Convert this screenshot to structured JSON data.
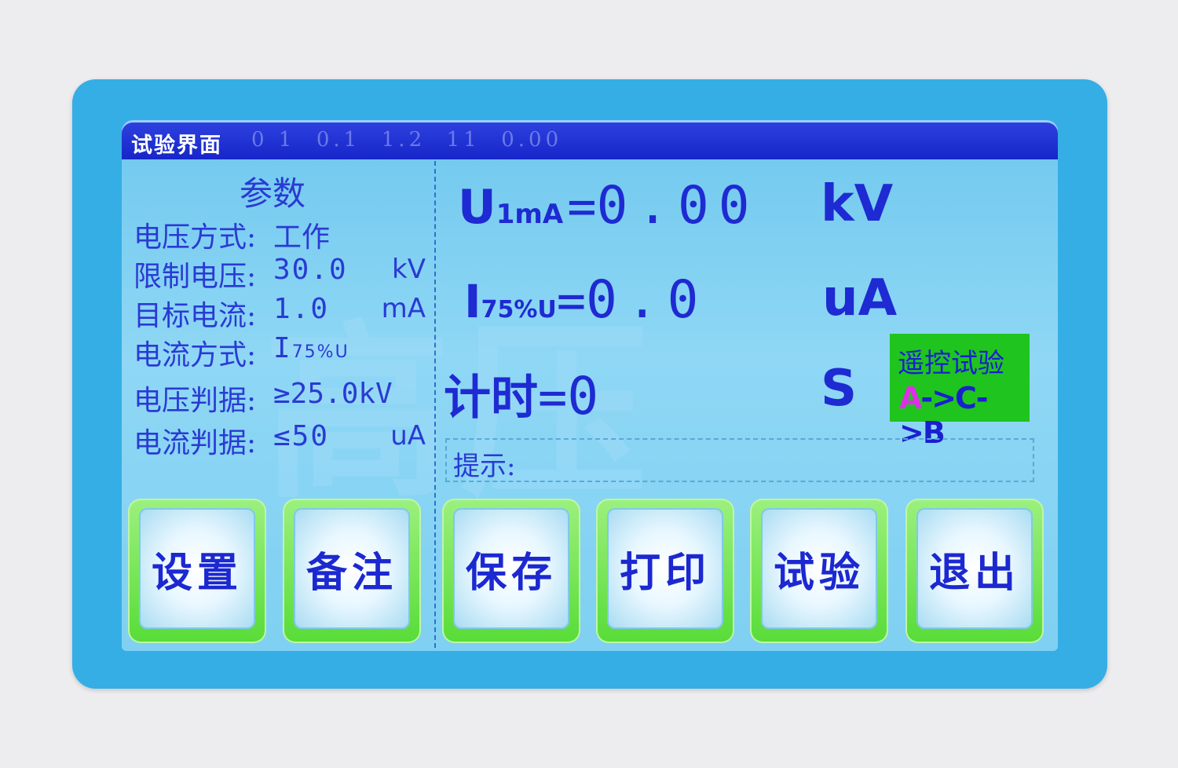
{
  "titlebar": {
    "title": "试验界面",
    "meta": "0 1  0.1  1.2  11  0.00"
  },
  "watermark": "高压",
  "params": {
    "title": "参数",
    "items": [
      {
        "label": "电压方式:",
        "value": "工作",
        "unit": ""
      },
      {
        "label": "限制电压:",
        "value": "30.0",
        "unit": "kV"
      },
      {
        "label": "目标电流:",
        "value": "1.0",
        "unit": "mA"
      },
      {
        "label": "电流方式:",
        "value": "I",
        "sub": "75%U",
        "unit": ""
      },
      {
        "label": "电压判据:",
        "value": "≥25.0kV",
        "unit": ""
      },
      {
        "label": "电流判据:",
        "value": "≤50",
        "unit": "uA"
      }
    ]
  },
  "readings": {
    "u1ma": {
      "name": "U",
      "sub": "1mA",
      "eq": "=",
      "value": "0.00",
      "unit": "kV"
    },
    "i75": {
      "name": "I",
      "sub": "75%U",
      "eq": "=",
      "value": "0.0",
      "unit": "uA"
    },
    "timer": {
      "name": "计时",
      "eq": "=",
      "value": "0",
      "unit": "S"
    }
  },
  "remote": {
    "line1": "遥控试验",
    "a": "A",
    "rest": "->C->B"
  },
  "hint": {
    "label": "提示:"
  },
  "buttons": [
    {
      "label": "设置"
    },
    {
      "label": "备注"
    },
    {
      "label": "保存"
    },
    {
      "label": "打印"
    },
    {
      "label": "试验"
    },
    {
      "label": "退出"
    }
  ],
  "colors": {
    "bezel": "#35aee6",
    "titlebar": "#1626c9",
    "text": "#1e2ad2",
    "button_rim": "#58dc38",
    "remote_bg": "#1fc41f",
    "remote_accent": "#e02ee8"
  }
}
